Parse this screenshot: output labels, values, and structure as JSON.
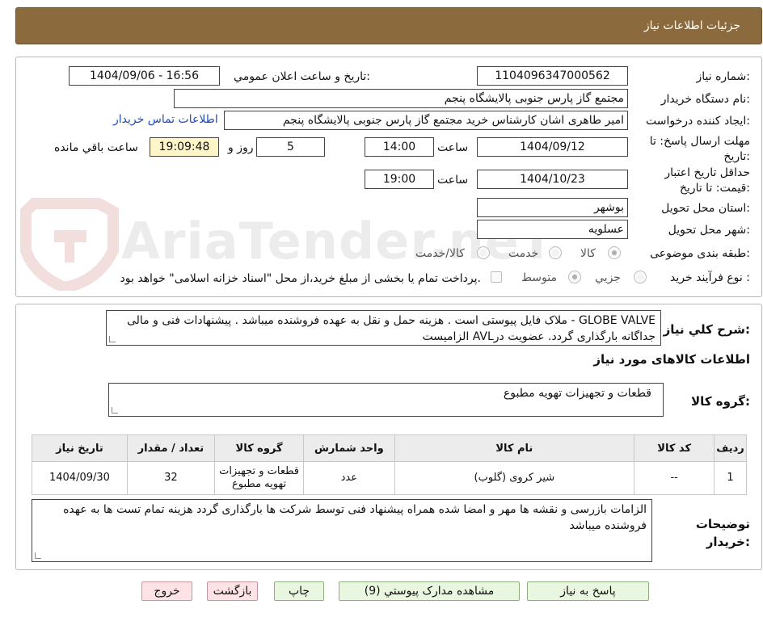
{
  "header": {
    "title": "جزئیات اطلاعات نیاز"
  },
  "watermark": {
    "text": "AriaTender.neT"
  },
  "form": {
    "need_number_label": "شماره نیاز:",
    "need_number": "1104096347000562",
    "announce_label": "تاریخ و ساعت اعلان عمومي:",
    "announce_value": "1404/09/06 - 16:56",
    "buyer_org_label": "نام دستگاه خریدار:",
    "buyer_org": "مجتمع گاز پارس جنوبی  پالایشگاه پنجم",
    "requester_label": "ایجاد کننده درخواست:",
    "requester": "امیر طاهری اشان کارشناس خرید مجتمع گاز پارس جنوبی  پالایشگاه پنجم",
    "contact_link": "اطلاعات تماس خریدار",
    "deadline_label": "مهلت ارسال پاسخ: تا تاریخ:",
    "deadline_date": "1404/09/12",
    "time_label": "ساعت",
    "deadline_time": "14:00",
    "days_value": "5",
    "days_label": "روز و",
    "remaining_time": "19:09:48",
    "remaining_label": "ساعت باقي مانده",
    "validity_label": "حداقل تاریخ اعتبار قیمت: تا تاریخ:",
    "validity_date": "1404/10/23",
    "validity_time": "19:00",
    "province_label": "استان محل تحویل:",
    "province": "بوشهر",
    "city_label": "شهر محل تحویل:",
    "city": "عسلویه",
    "category_label": "طبقه بندی موضوعی:",
    "category_options": [
      "کالا",
      "خدمت",
      "کالا/خدمت"
    ],
    "category_selected": "کالا",
    "process_label": "نوع فرآیند خرید :",
    "process_options": [
      "جزیي",
      "متوسط"
    ],
    "process_selected": "متوسط",
    "payment_note": "پرداخت تمام یا بخشی از مبلغ خرید،از محل \"اسناد خزانه اسلامی\" خواهد بود."
  },
  "summary": {
    "label": "شرح کلي نیاز:",
    "text": "GLOBE VALVE - ملاک فایل پیوستی است . هزینه حمل و نقل به عهده فروشنده میباشد . پیشنهادات فنی و مالی جداگانه بارگذاری گردد. عضویت درAVL الزامیست"
  },
  "goods": {
    "section_title": "اطلاعات کالاهای مورد نیاز",
    "group_label": "گروه کالا:",
    "group_value": "قطعات و تجهیزات تهویه مطبوع",
    "table": {
      "headers": [
        "ردیف",
        "کد کالا",
        "نام کالا",
        "واحد شمارش",
        "گروه کالا",
        "تعداد / مقدار",
        "تاریخ نیاز"
      ],
      "rows": [
        {
          "row": "1",
          "code": "--",
          "name": "شیر کروی (گلوب)",
          "unit": "عدد",
          "group": "قطعات و تجهیزات تهویه مطبوع",
          "qty": "32",
          "date": "1404/09/30"
        }
      ]
    }
  },
  "buyer_notes": {
    "label": "توضیحات خریدار:",
    "text": "الزامات بازرسی و نقشه ها مهر و امضا شده همراه پیشنهاد فنی توسط شرکت ها بارگذاری گردد هزینه تمام تست ها به عهده فروشنده میباشد"
  },
  "buttons": {
    "reply": "پاسخ به نیاز",
    "attachments": "مشاهده مدارک پیوستي (9)",
    "print": "چاپ",
    "back": "بازگشت",
    "exit": "خروج"
  },
  "colors": {
    "header_bg": "#8b6b3e",
    "remaining_bg": "#fff5c8",
    "link": "#1f4db8",
    "green_button": "#e9f6e0",
    "pink_button": "#fde3e6"
  }
}
